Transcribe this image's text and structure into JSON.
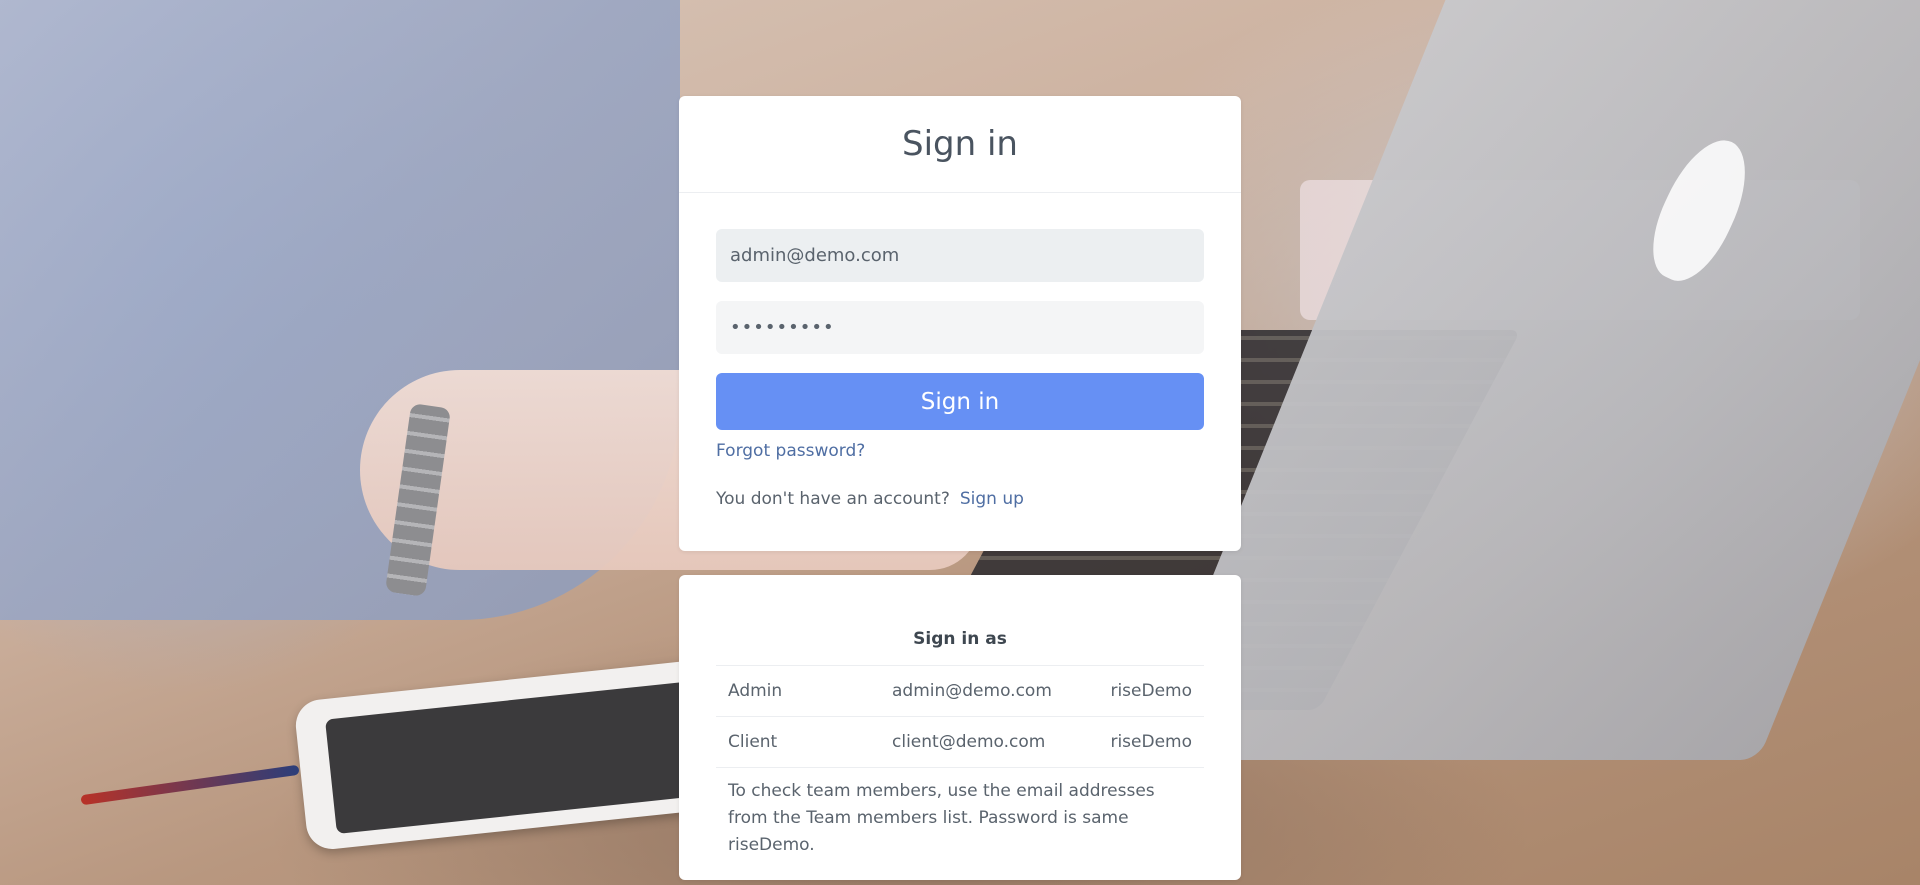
{
  "signin": {
    "title": "Sign in",
    "email_value": "admin@demo.com",
    "password_value": "•••••••••",
    "submit_label": "Sign in",
    "forgot_label": "Forgot password?",
    "no_account_text": "You don't have an account?",
    "signup_label": "Sign up"
  },
  "demo": {
    "heading": "Sign in as",
    "rows": [
      {
        "role": "Admin",
        "email": "admin@demo.com",
        "password": "riseDemo"
      },
      {
        "role": "Client",
        "email": "client@demo.com",
        "password": "riseDemo"
      }
    ],
    "note": "To check team members, use the email addresses from the Team members list. Password is same riseDemo."
  },
  "colors": {
    "primary_button": "#6690f4",
    "link": "#4f6ea3",
    "text": "#5a636d",
    "title": "#4a5460"
  }
}
